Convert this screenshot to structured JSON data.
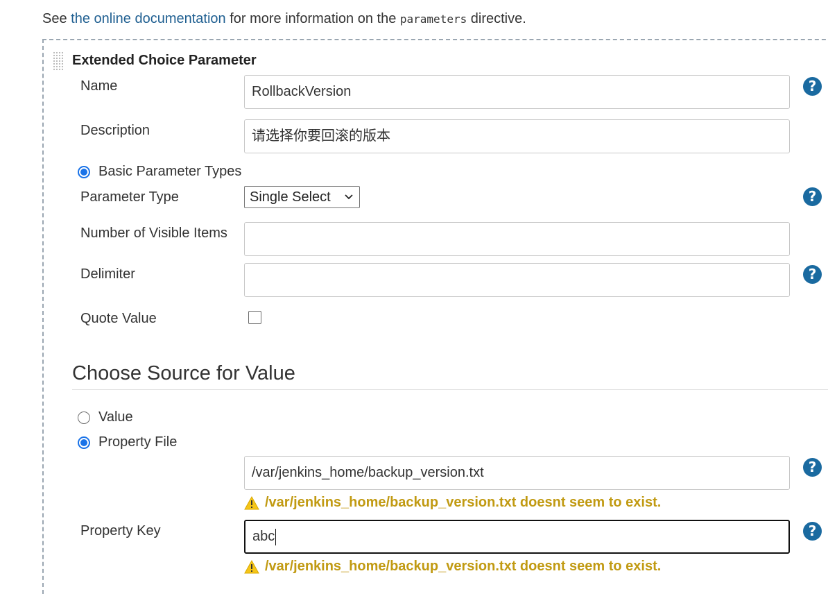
{
  "intro": {
    "prefix": "See ",
    "link": "the online documentation",
    "middle": " for more information on the ",
    "code": "parameters",
    "suffix": " directive."
  },
  "section": {
    "title": "Extended Choice Parameter"
  },
  "fields": {
    "name": {
      "label": "Name",
      "value": "RollbackVersion"
    },
    "description": {
      "label": "Description",
      "value": "请选择你要回滚的版本"
    },
    "basic_types_label": "Basic Parameter Types",
    "parameter_type": {
      "label": "Parameter Type",
      "value": "Single Select"
    },
    "visible_items": {
      "label": "Number of Visible Items",
      "value": ""
    },
    "delimiter": {
      "label": "Delimiter",
      "value": ""
    },
    "quote_value": {
      "label": "Quote Value",
      "checked": false
    }
  },
  "source": {
    "heading": "Choose Source for Value",
    "options": [
      "Value",
      "Property File"
    ],
    "selected": "Property File",
    "property_file": {
      "value": "/var/jenkins_home/backup_version.txt"
    },
    "warning": "/var/jenkins_home/backup_version.txt  doesnt seem to exist.",
    "property_key": {
      "label": "Property Key",
      "value": "abc"
    },
    "warning_2": "/var/jenkins_home/backup_version.txt  doesnt seem to exist."
  },
  "help_glyph": "?",
  "colors": {
    "link": "#1f5f91",
    "help": "#1a6aa0",
    "warning": "#c19a12",
    "radio": "#1a73e8"
  }
}
